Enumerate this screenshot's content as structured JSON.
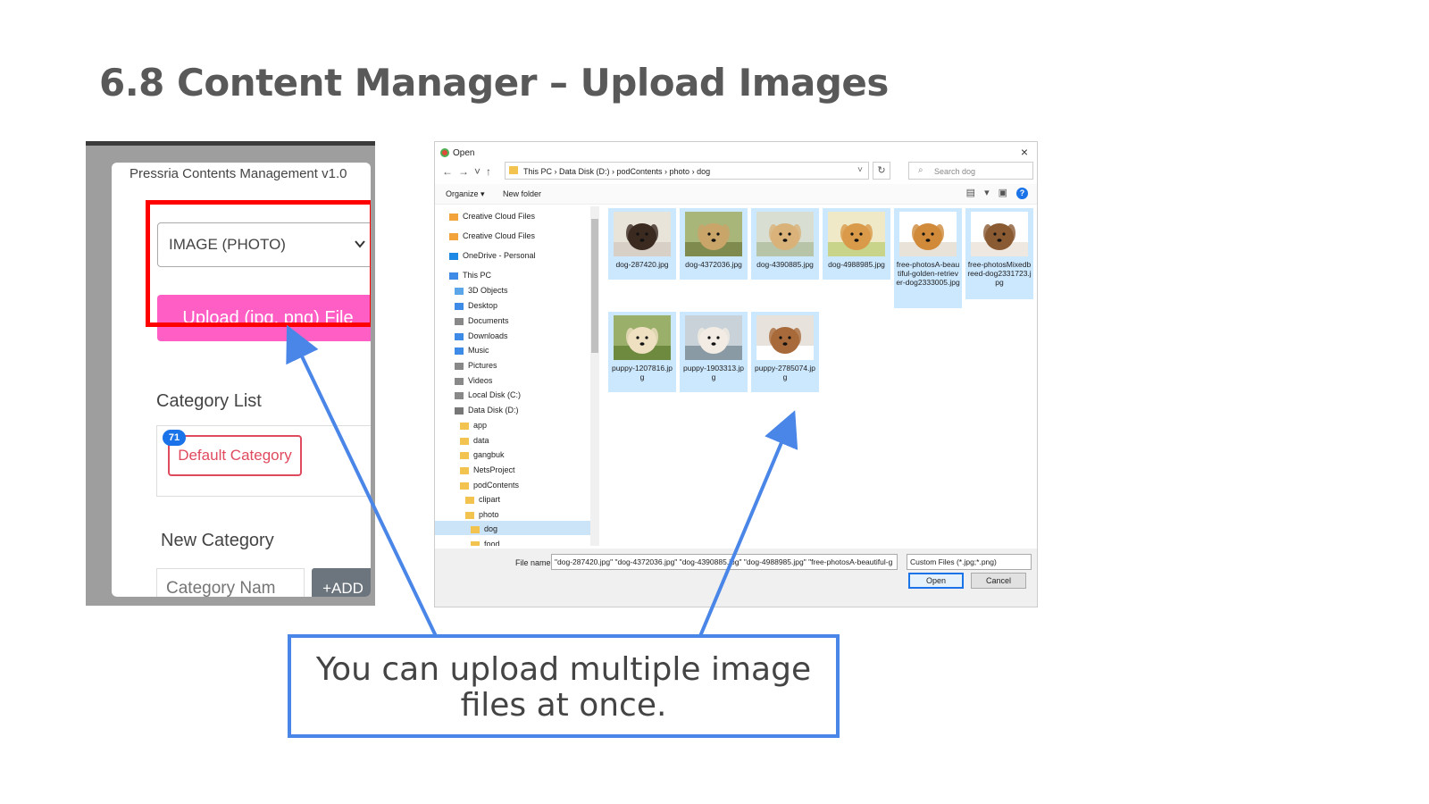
{
  "slide": {
    "title": "6.8 Content Manager – Upload Images"
  },
  "cms": {
    "app_title": "Pressria Contents Management v1.0",
    "type_select": {
      "value": "IMAGE (PHOTO)"
    },
    "upload_button": "Upload (jpg, png) File",
    "category_list_label": "Category List",
    "categories": [
      {
        "label": "Default Category",
        "count": "71"
      }
    ],
    "new_category_label": "New Category",
    "category_input_placeholder": "Category Nam",
    "add_button": "+ADD",
    "colors": {
      "upload": "#ff5fc5",
      "highlight": "#ff0000",
      "badge": "#1a73e8"
    }
  },
  "dialog": {
    "title": "Open",
    "close": "×",
    "breadcrumb": "This PC  ›  Data Disk (D:)  ›  podContents  ›  photo  ›  dog",
    "search_placeholder": "Search dog",
    "organize": "Organize ▾",
    "new_folder": "New folder",
    "nav_items": [
      "Creative Cloud Files",
      "Creative Cloud Files",
      "OneDrive - Personal",
      "This PC",
      "3D Objects",
      "Desktop",
      "Documents",
      "Downloads",
      "Music",
      "Pictures",
      "Videos",
      "Local Disk (C:)",
      "Data Disk (D:)",
      "app",
      "data",
      "gangbuk",
      "NetsProject",
      "podContents",
      "clipart",
      "photo",
      "dog",
      "food"
    ],
    "files": [
      "dog-287420.jpg",
      "dog-4372036.jpg",
      "dog-4390885.jpg",
      "dog-4988985.jpg",
      "free-photosA-beautiful-golden-retriever-dog2333005.jpg",
      "free-photosMixedbreed-dog2331723.jpg",
      "puppy-1207816.jpg",
      "puppy-1903313.jpg",
      "puppy-2785074.jpg"
    ],
    "file_name_label": "File name:",
    "file_name_value": "\"dog-287420.jpg\" \"dog-4372036.jpg\" \"dog-4390885.jpg\" \"dog-4988985.jpg\" \"free-photosA-beautiful-g",
    "file_type": "Custom Files (*.jpg;*.png)",
    "open_button": "Open",
    "cancel_button": "Cancel"
  },
  "callout": {
    "text": "You can upload multiple image files at once."
  },
  "colors": {
    "callout_border": "#4a86e8",
    "tile_selected": "#cce8ff"
  }
}
